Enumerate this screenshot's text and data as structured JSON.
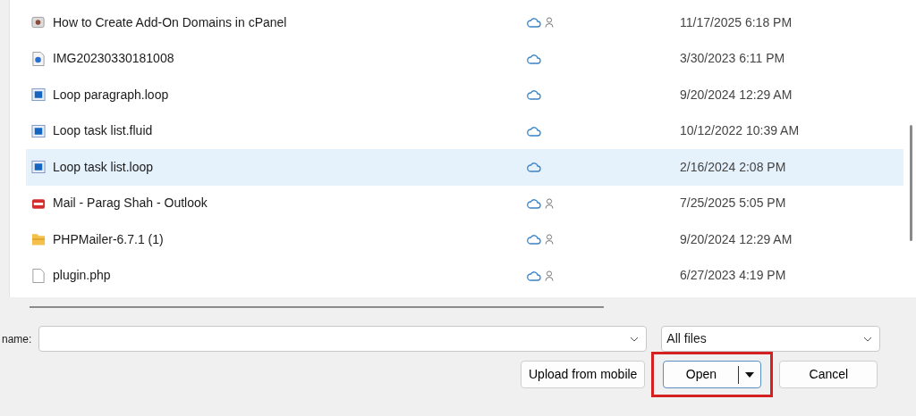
{
  "files": [
    {
      "name": "How to Create Add-On Domains in cPanel",
      "kind": "media",
      "shared": true,
      "modified": "11/17/2025 6:18 PM",
      "selected": false
    },
    {
      "name": "IMG20230330181008",
      "kind": "image",
      "shared": false,
      "modified": "3/30/2023 6:11 PM",
      "selected": false
    },
    {
      "name": "Loop paragraph.loop",
      "kind": "loop",
      "shared": false,
      "modified": "9/20/2024 12:29 AM",
      "selected": false
    },
    {
      "name": "Loop task list.fluid",
      "kind": "loop",
      "shared": false,
      "modified": "10/12/2022 10:39 AM",
      "selected": false
    },
    {
      "name": "Loop task list.loop",
      "kind": "loop",
      "shared": false,
      "modified": "2/16/2024 2:08 PM",
      "selected": true
    },
    {
      "name": "Mail - Parag Shah - Outlook",
      "kind": "pdf",
      "shared": true,
      "modified": "7/25/2025 5:05 PM",
      "selected": false
    },
    {
      "name": "PHPMailer-6.7.1 (1)",
      "kind": "folder",
      "shared": true,
      "modified": "9/20/2024 12:29 AM",
      "selected": false
    },
    {
      "name": "plugin.php",
      "kind": "document",
      "shared": true,
      "modified": "6/27/2023 4:19 PM",
      "selected": false
    }
  ],
  "file_name": {
    "label": "name:"
  },
  "file_type": {
    "value": "All files"
  },
  "buttons": [
    {
      "label": "Upload from mobile",
      "kind": "plain",
      "highlighted": false
    },
    {
      "label": "Open",
      "kind": "split",
      "highlighted": true
    },
    {
      "label": "Cancel",
      "kind": "plain",
      "highlighted": false
    }
  ]
}
